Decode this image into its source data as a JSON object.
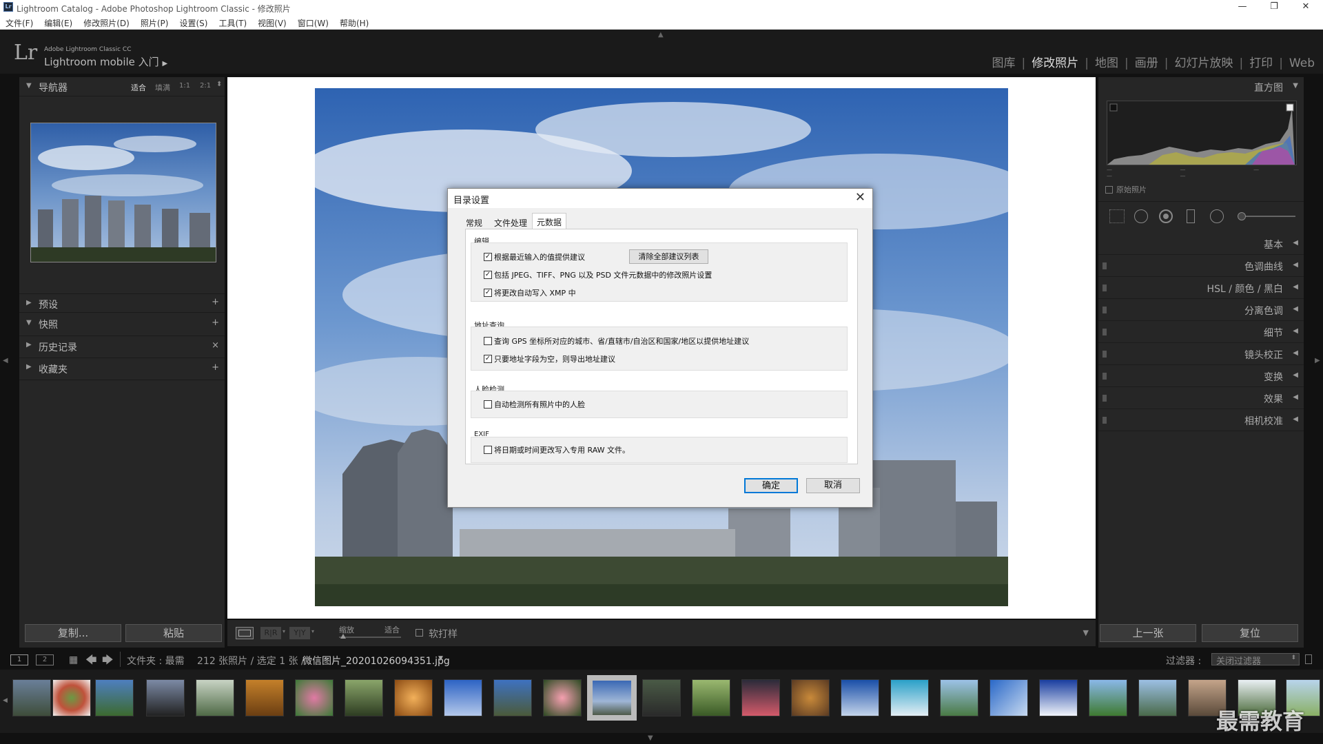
{
  "window": {
    "title": "Lightroom Catalog - Adobe Photoshop Lightroom Classic - 修改照片",
    "app_icon": "Lr",
    "controls": [
      "minimize-icon",
      "restore-icon",
      "close-icon"
    ]
  },
  "menu": [
    "文件(F)",
    "编辑(E)",
    "修改照片(D)",
    "照片(P)",
    "设置(S)",
    "工具(T)",
    "视图(V)",
    "窗口(W)",
    "帮助(H)"
  ],
  "header": {
    "logo": "Lr",
    "sub1": "Adobe Lightroom Classic CC",
    "sub2": "Lightroom mobile 入门",
    "modules": [
      "图库",
      "修改照片",
      "地图",
      "画册",
      "幻灯片放映",
      "打印",
      "Web"
    ],
    "active_module": "修改照片"
  },
  "left_panel": {
    "navigator": {
      "label": "导航器",
      "zoom": [
        "适合",
        "填满",
        "1:1",
        "2:1"
      ]
    },
    "sections": [
      {
        "label": "预设",
        "action": "+"
      },
      {
        "label": "快照",
        "action": "+"
      },
      {
        "label": "历史记录",
        "action": "×"
      },
      {
        "label": "收藏夹",
        "action": "+"
      }
    ],
    "copy_btn": "复制...",
    "paste_btn": "粘贴"
  },
  "right_panel": {
    "histogram_label": "直方图",
    "original_photo": "原始照片",
    "sections": [
      "基本",
      "色调曲线",
      "HSL / 颜色 / 黑白",
      "分离色调",
      "细节",
      "镜头校正",
      "变换",
      "效果",
      "相机校准"
    ],
    "prev_btn": "上一张",
    "reset_btn": "复位"
  },
  "toolbar": {
    "zoom_label": "缩放",
    "fit_label": "适合",
    "soft_proof": "软打样"
  },
  "filmbar": {
    "pages": [
      "1",
      "2"
    ],
    "folder": "文件夹 : 最需",
    "count": "212 张照片 / 选定 1 张 /",
    "filename": "微信图片_20201026094351.jpg",
    "filter_label": "过滤器 :",
    "filter_value": "关闭过滤器"
  },
  "watermark": "最需教育",
  "dialog": {
    "title": "目录设置",
    "tabs": [
      "常规",
      "文件处理",
      "元数据"
    ],
    "active_tab": "元数据",
    "groups": [
      {
        "title": "编辑",
        "options": [
          {
            "label": "根据最近输入的值提供建议",
            "checked": true
          },
          {
            "label": "包括 JPEG、TIFF、PNG 以及 PSD 文件元数据中的修改照片设置",
            "checked": true
          },
          {
            "label": "将更改自动写入 XMP 中",
            "checked": true
          }
        ],
        "button": "清除全部建议列表"
      },
      {
        "title": "地址查询",
        "options": [
          {
            "label": "查询 GPS 坐标所对应的城市、省/直辖市/自治区和国家/地区以提供地址建议",
            "checked": false
          },
          {
            "label": "只要地址字段为空，则导出地址建议",
            "checked": true
          }
        ]
      },
      {
        "title": "人脸检测",
        "options": [
          {
            "label": "自动检测所有照片中的人脸",
            "checked": false
          }
        ]
      },
      {
        "title": "EXIF",
        "options": [
          {
            "label": "将日期或时间更改写入专用 RAW 文件。",
            "checked": false
          }
        ]
      }
    ],
    "ok": "确定",
    "cancel": "取消"
  }
}
